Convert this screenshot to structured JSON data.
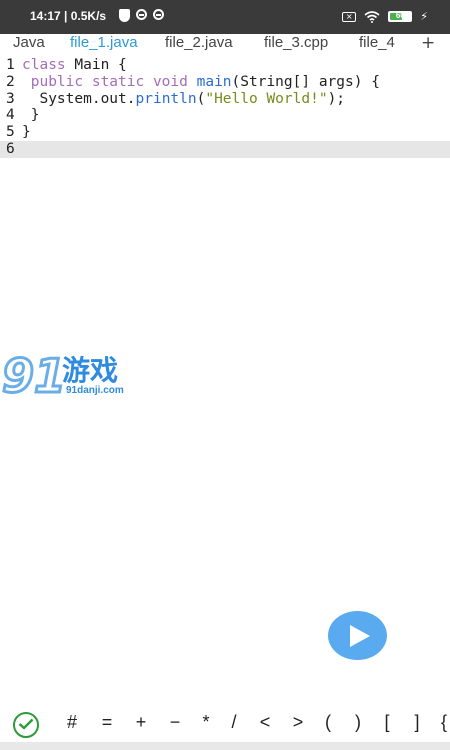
{
  "status_bar": {
    "time_speed": "14:17 | 0.5K/s",
    "battery_level": "60",
    "battery_percent": 0.6,
    "sim_label": "×"
  },
  "tabs": [
    {
      "label": "Java",
      "active": false
    },
    {
      "label": "file_1.java",
      "active": true
    },
    {
      "label": "file_2.java",
      "active": false
    },
    {
      "label": "file_3.cpp",
      "active": false
    },
    {
      "label": "file_4",
      "active": false
    }
  ],
  "add_tab_label": "+",
  "editor": {
    "lines": [
      {
        "number": "1",
        "tokens": [
          {
            "t": "class",
            "c": "kw"
          },
          {
            "t": " Main {",
            "c": ""
          }
        ]
      },
      {
        "number": "2",
        "tokens": [
          {
            "t": " public static void ",
            "c": "kw"
          },
          {
            "t": "main",
            "c": "fn"
          },
          {
            "t": "(String[] args) {",
            "c": ""
          }
        ]
      },
      {
        "number": "3",
        "tokens": [
          {
            "t": "  System.out.",
            "c": ""
          },
          {
            "t": "println",
            "c": "fn"
          },
          {
            "t": "(",
            "c": ""
          },
          {
            "t": "\"Hello World!\"",
            "c": "str"
          },
          {
            "t": ");",
            "c": ""
          }
        ]
      },
      {
        "number": "4",
        "tokens": [
          {
            "t": " }",
            "c": ""
          }
        ]
      },
      {
        "number": "5",
        "tokens": [
          {
            "t": "}",
            "c": ""
          }
        ]
      },
      {
        "number": "6",
        "tokens": []
      }
    ],
    "current_line": "6"
  },
  "watermark": {
    "logo_text": "91游戏",
    "site": "91danji.com"
  },
  "symbol_bar": {
    "symbols": [
      "#",
      "=",
      "+",
      "−",
      "*",
      "/",
      "<",
      ">",
      "(",
      ")",
      "[",
      "]",
      "{"
    ]
  },
  "colors": {
    "active_tab": "#2e9bd6",
    "run_button": "#5aaaf0",
    "check_icon": "#2e9a3a",
    "keyword": "#a56db8",
    "function": "#2b6cd4",
    "string": "#7a8a1c"
  }
}
